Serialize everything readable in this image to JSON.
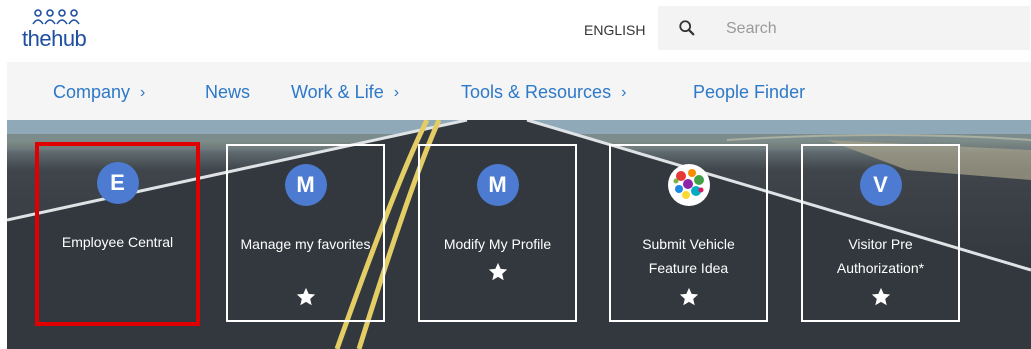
{
  "header": {
    "logo_text": "thehub",
    "language": "ENGLISH",
    "search": {
      "placeholder": "Search"
    }
  },
  "nav": [
    {
      "label": "Company",
      "has_chevron": true
    },
    {
      "label": "News",
      "has_chevron": false
    },
    {
      "label": "Work & Life",
      "has_chevron": true
    },
    {
      "label": "Tools & Resources",
      "has_chevron": true
    },
    {
      "label": "People Finder",
      "has_chevron": false
    }
  ],
  "tiles": [
    {
      "initial": "E",
      "label": "Employee Central",
      "favorite": false,
      "selected": true
    },
    {
      "initial": "M",
      "label": "Manage my favorites",
      "favorite": true,
      "selected": false
    },
    {
      "initial": "M",
      "label": "Modify My Profile",
      "favorite": true,
      "selected": false
    },
    {
      "initial": "",
      "icon": "colorful-dots-icon",
      "label": "Submit Vehicle Feature Idea",
      "favorite": true,
      "selected": false
    },
    {
      "initial": "V",
      "label": "Visitor Pre Authorization*",
      "favorite": true,
      "selected": false
    }
  ],
  "colors": {
    "accent": "#2d78c8",
    "avatar": "#4c7bd1",
    "selection": "#e10000"
  },
  "icons": {
    "search": "magnifier-icon",
    "chevron": "chevron-right-icon",
    "favorite": "star-icon"
  }
}
